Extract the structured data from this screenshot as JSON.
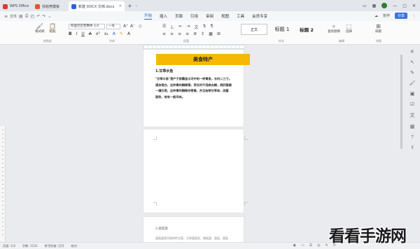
{
  "tabs": [
    {
      "label": "WPS Office",
      "color": "#d93a2b"
    },
    {
      "label": "找稻壳模板",
      "color": "#e2572a"
    },
    {
      "label": "新建 DOCX 文档.docx",
      "color": "#2b62d6"
    }
  ],
  "window": {
    "new_tab": "+",
    "tab_list": "⌄"
  },
  "menu": {
    "file_label": "文件",
    "tabs": [
      "开始",
      "插入",
      "页面",
      "引用",
      "审阅",
      "视图",
      "工具",
      "会员专享"
    ],
    "active_tab": "开始",
    "share_label": "分享",
    "collab_label": "协作",
    "more": "⋮"
  },
  "ribbon": {
    "format_painter": "格式刷",
    "paste": "粘贴",
    "font_name": "阿里巴巴普惠体 3.0",
    "font_size": "一号",
    "styles": {
      "normal": "正文",
      "h1": "标题 1",
      "h2": "标题 2"
    },
    "find_replace": "查找替换",
    "select": "选择",
    "sort": "排版",
    "group_labels": [
      "剪贴板",
      "字体",
      "段落",
      "样式",
      "编辑",
      "排版"
    ]
  },
  "document": {
    "title": "美食特产",
    "section1_heading": "1.甘草水鱼",
    "section1_lines": [
      "\"甘草水鱼\"是产于那霸县水河中的一种青鱼，长约二三寸。",
      "通体银白，这种青的鳞稀薄，烹饪时不用麻去鳞，柄肝腹嫩",
      "一撮仍是，这种青的鳞稀亦密嫩，并且始带甘草味，因着",
      "甜软，故有一般风味。"
    ],
    "section2_heading": "2.菌菇菌",
    "section2_line": "菌菇菌是洱海特色名菜，又称菌菇鱼、棚菇菌、菌菇、菌菇"
  },
  "status": {
    "page": "页面: 1/3",
    "words": "字数: 1131",
    "spell": "拼写检查: 打开",
    "proofread": "校对"
  },
  "watermark": "看看手游网",
  "colors": {
    "accent": "#2b62d6",
    "title_bg": "#f6b800",
    "share_bg": "#3d72e0"
  }
}
